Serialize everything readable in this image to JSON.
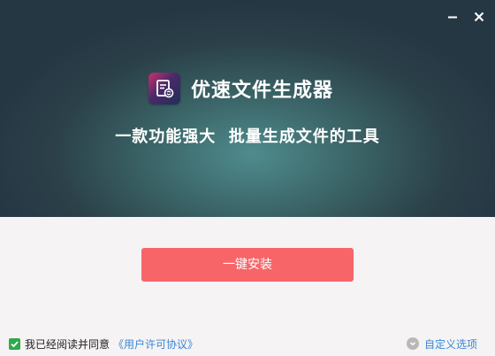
{
  "window": {
    "minimize_icon": "minimize-icon",
    "close_icon": "close-icon"
  },
  "header": {
    "app_icon": "document-refresh-icon",
    "app_name": "优速文件生成器",
    "tagline": "一款功能强大  批量生成文件的工具"
  },
  "main": {
    "install_label": "一键安装"
  },
  "footer": {
    "agree_checked": true,
    "agree_text": "我已经阅读并同意",
    "license_link": "《用户许可协议》",
    "custom_options": "自定义选项",
    "custom_options_icon": "chevron-down-icon"
  },
  "colors": {
    "install_button": "#f86569",
    "link": "#3a86d6",
    "checkbox": "#2fa94a",
    "hero_dark": "#263744",
    "hero_light": "#4f8b8d"
  }
}
